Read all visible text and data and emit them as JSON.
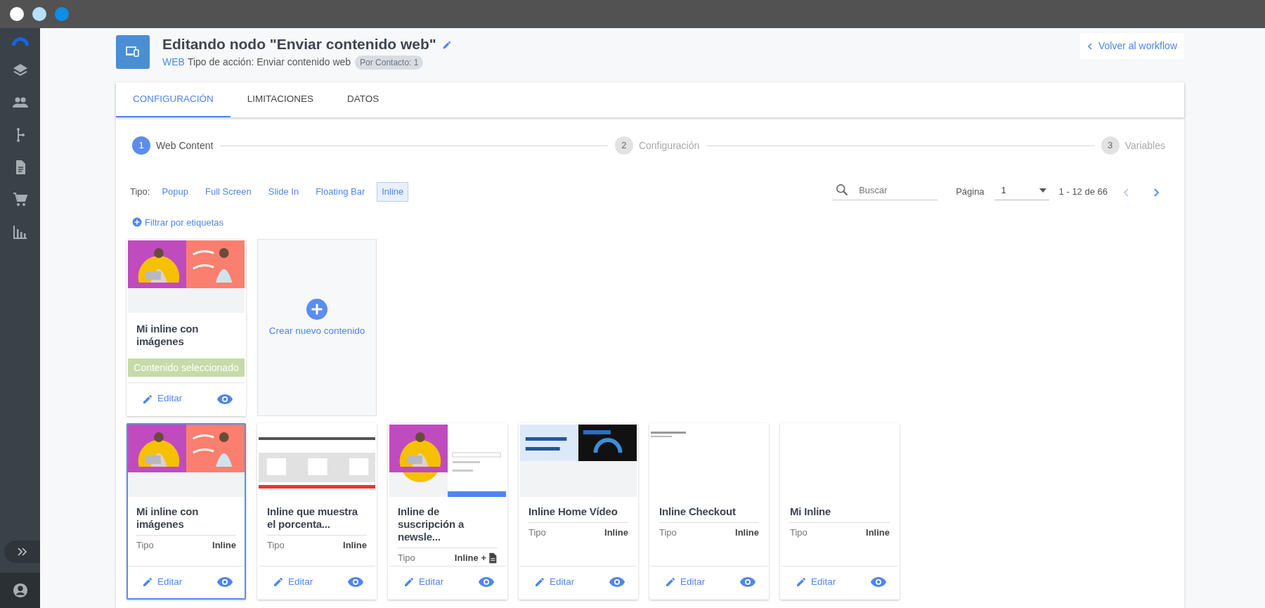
{
  "header": {
    "title": "Editando nodo \"Enviar contenido web\"",
    "channel": "WEB",
    "action_type": "Tipo de acción: Enviar contenido web",
    "badge": "Por Contacto: 1",
    "back_button": "Volver al workflow"
  },
  "tabs": [
    {
      "label": "CONFIGURACIÓN",
      "selected": true
    },
    {
      "label": "LIMITACIONES",
      "selected": false
    },
    {
      "label": "DATOS",
      "selected": false
    }
  ],
  "steps": [
    {
      "number": "1",
      "label": "Web Content",
      "active": true
    },
    {
      "number": "2",
      "label": "Configuración",
      "active": false
    },
    {
      "number": "3",
      "label": "Variables",
      "active": false
    }
  ],
  "type_filter": {
    "label": "Tipo:",
    "options": [
      {
        "label": "Popup",
        "selected": false
      },
      {
        "label": "Full Screen",
        "selected": false
      },
      {
        "label": "Slide In",
        "selected": false
      },
      {
        "label": "Floating Bar",
        "selected": false
      },
      {
        "label": "Inline",
        "selected": true
      }
    ]
  },
  "search": {
    "placeholder": "Buscar"
  },
  "pagination": {
    "label": "Página",
    "page": "1",
    "range": "1 - 12 de 66"
  },
  "tag_filter": "Filtrar por etiquetas",
  "selected_content": {
    "title": "Mi inline con imágenes",
    "status": "Contenido seleccionado",
    "edit": "Editar"
  },
  "create_card": "Crear nuevo contenido",
  "cards": [
    {
      "title": "Mi inline con imágenes",
      "type_label": "Tipo",
      "type_value": "Inline",
      "doc_icon": false,
      "selected": true,
      "edit": "Editar"
    },
    {
      "title": "Inline que muestra el porcenta...",
      "type_label": "Tipo",
      "type_value": "Inline",
      "doc_icon": false,
      "selected": false,
      "edit": "Editar"
    },
    {
      "title": "Inline de suscripción a newsle...",
      "type_label": "Tipo",
      "type_value": "Inline +",
      "doc_icon": true,
      "selected": false,
      "edit": "Editar"
    },
    {
      "title": "Inline Home Vídeo",
      "type_label": "Tipo",
      "type_value": "Inline",
      "doc_icon": false,
      "selected": false,
      "edit": "Editar"
    },
    {
      "title": "Inline Checkout",
      "type_label": "Tipo",
      "type_value": "Inline",
      "doc_icon": false,
      "selected": false,
      "edit": "Editar"
    },
    {
      "title": "Mi Inline",
      "type_label": "Tipo",
      "type_value": "Inline",
      "doc_icon": false,
      "selected": false,
      "edit": "Editar",
      "thumbnail": {
        "kind": "blank"
      }
    }
  ]
}
